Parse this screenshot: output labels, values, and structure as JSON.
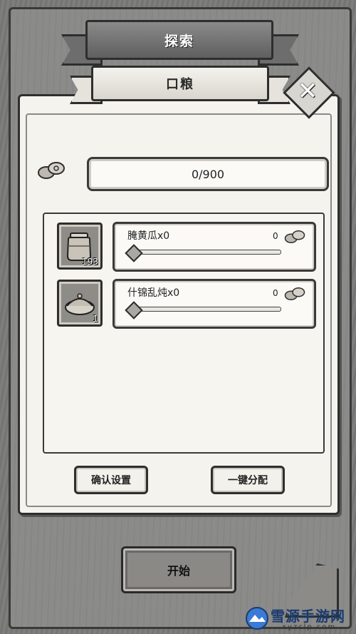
{
  "header": {
    "explore_title": "探索",
    "ration_title": "口粮"
  },
  "close_button": {
    "icon": "close-icon",
    "label": "✕"
  },
  "ration": {
    "icon": "coin-icon",
    "value": "0/900"
  },
  "items": [
    {
      "name": "腌黄瓜x0",
      "count": "193",
      "qty": "0",
      "icon": "pickle-jar-icon",
      "slider_value": 0
    },
    {
      "name": "什锦乱炖x0",
      "count": "1",
      "qty": "0",
      "icon": "stew-bowl-icon",
      "slider_value": 0
    }
  ],
  "buttons": {
    "confirm": "确认设置",
    "auto": "一键分配",
    "start": "开始"
  },
  "watermark": {
    "title": "雪源手游网",
    "url": "xyzclp.com"
  },
  "colors": {
    "panel": "#f5f3ee",
    "board": "#8b8b89",
    "outline": "#2e2e2e",
    "watermark": "#1c3b6e"
  }
}
